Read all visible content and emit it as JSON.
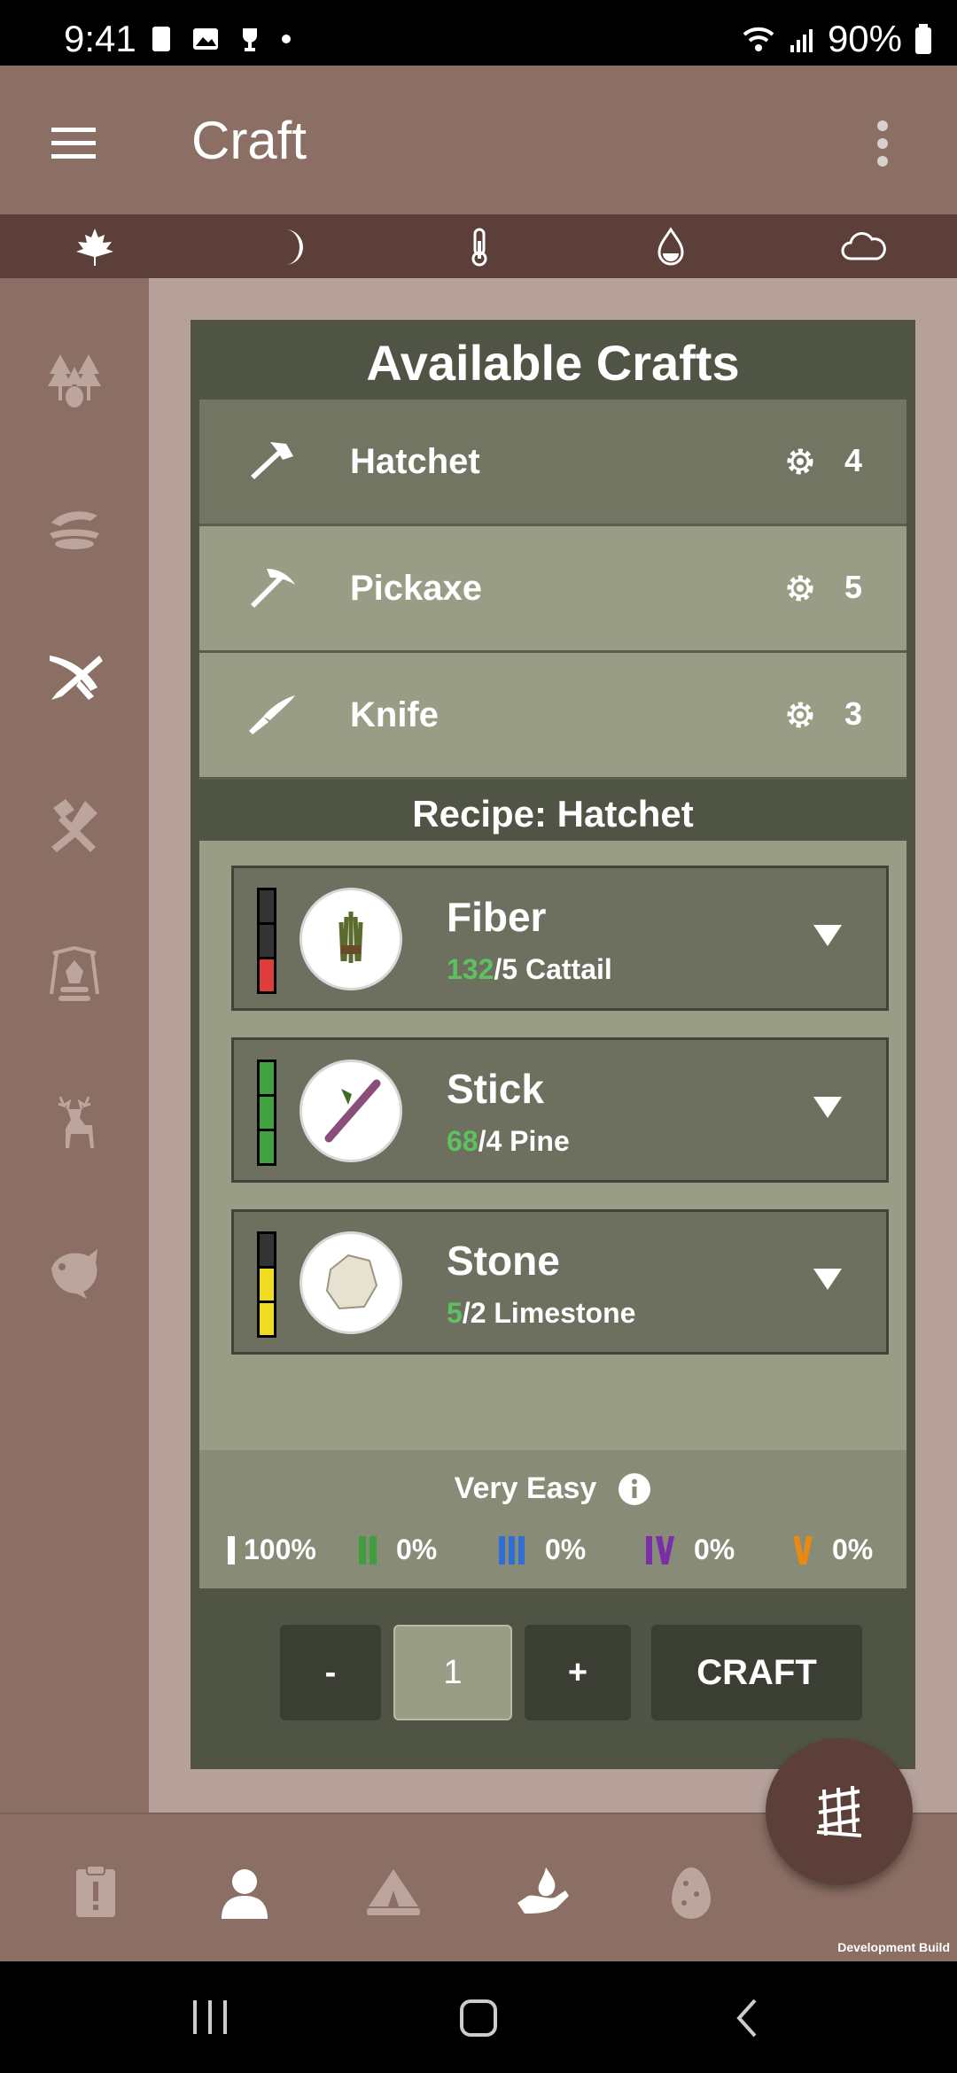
{
  "status_bar": {
    "time": "9:41",
    "battery": "90%"
  },
  "app_bar": {
    "title": "Craft"
  },
  "weather_icons": [
    "leaf-icon",
    "moon-icon",
    "thermometer-icon",
    "water-drop-icon",
    "cloud-icon"
  ],
  "side_nav": [
    "forest-icon",
    "foraging-icon",
    "crafting-icon",
    "tools-icon",
    "campfire-icon",
    "deer-icon",
    "fish-icon"
  ],
  "crafts": {
    "heading": "Available Crafts",
    "items": [
      {
        "label": "Hatchet",
        "count": "4"
      },
      {
        "label": "Pickaxe",
        "count": "5"
      },
      {
        "label": "Knife",
        "count": "3"
      }
    ]
  },
  "recipe": {
    "heading": "Recipe: Hatchet",
    "ingredients": [
      {
        "name": "Fiber",
        "have": "132",
        "rest": "/5 Cattail",
        "levels": [
          "#333",
          "#333",
          "#e03c3c"
        ]
      },
      {
        "name": "Stick",
        "have": "68",
        "rest": "/4 Pine",
        "levels": [
          "#3fa33f",
          "#3fa33f",
          "#3fa33f"
        ]
      },
      {
        "name": "Stone",
        "have": "5",
        "rest": "/2 Limestone",
        "levels": [
          "#333",
          "#f0dc1e",
          "#f0dc1e"
        ]
      }
    ],
    "difficulty": "Very Easy",
    "tiers": [
      {
        "mark": "I",
        "value": "100%",
        "color": "#ffffff"
      },
      {
        "mark": "II",
        "value": "0%",
        "color": "#3e9e3e"
      },
      {
        "mark": "III",
        "value": "0%",
        "color": "#2f6fd4"
      },
      {
        "mark": "IV",
        "value": "0%",
        "color": "#7a2fa8"
      },
      {
        "mark": "V",
        "value": "0%",
        "color": "#e88a12"
      }
    ]
  },
  "controls": {
    "minus": "-",
    "quantity": "1",
    "plus": "+",
    "craft": "CRAFT"
  },
  "bottom_nav": [
    "journal-icon",
    "character-icon",
    "shelter-icon",
    "fire-hand-icon",
    "egg-icon"
  ],
  "fab_icon": "fence-icon",
  "dev_label": "Development Build"
}
